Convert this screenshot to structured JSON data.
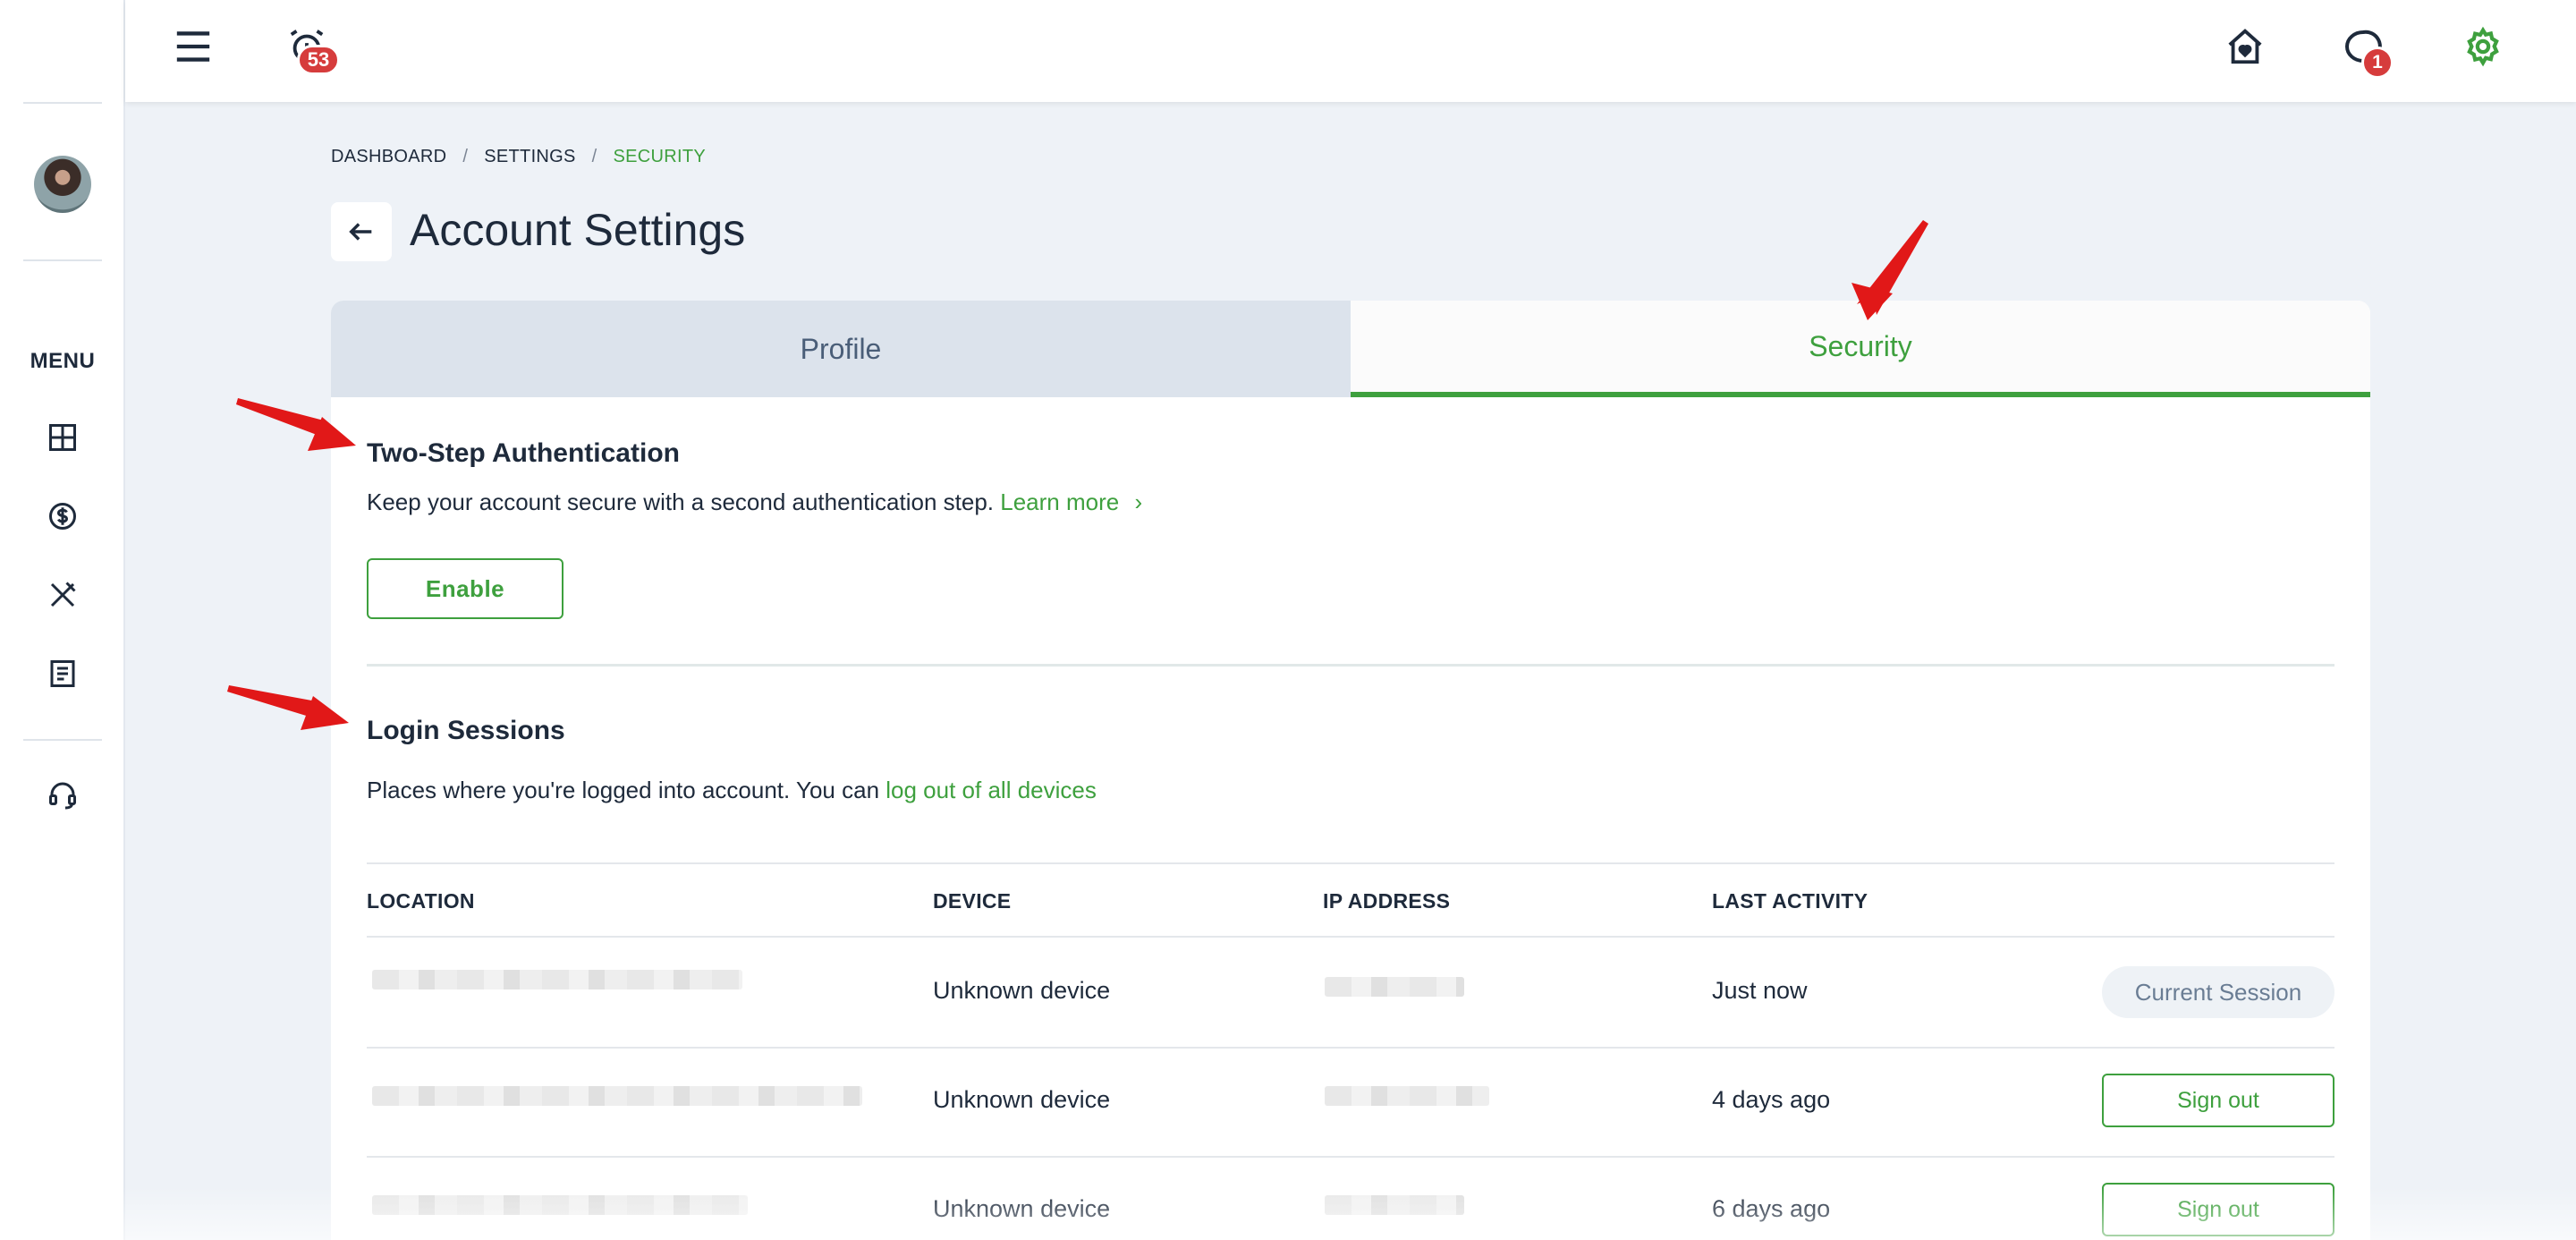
{
  "topbar": {
    "alarm_badge": "53",
    "chat_badge": "1"
  },
  "sidebar": {
    "menu_label": "MENU"
  },
  "breadcrumb": {
    "items": [
      "DASHBOARD",
      "SETTINGS",
      "SECURITY"
    ],
    "separator": "/"
  },
  "page": {
    "title": "Account Settings"
  },
  "tabs": [
    {
      "label": "Profile",
      "active": false
    },
    {
      "label": "Security",
      "active": true
    }
  ],
  "two_step": {
    "heading": "Two-Step Authentication",
    "description": "Keep your account secure with a second authentication step.",
    "learn_more": "Learn more",
    "enable_label": "Enable"
  },
  "sessions": {
    "heading": "Login Sessions",
    "description": "Places where you're logged into account. You can",
    "logout_link": "log out of all devices",
    "columns": [
      "LOCATION",
      "DEVICE",
      "IP ADDRESS",
      "LAST ACTIVITY"
    ],
    "rows": [
      {
        "device": "Unknown device",
        "last_activity": "Just now",
        "action": "Current Session"
      },
      {
        "device": "Unknown device",
        "last_activity": "4 days ago",
        "action": "Sign out"
      },
      {
        "device": "Unknown device",
        "last_activity": "6 days ago",
        "action": "Sign out"
      }
    ]
  },
  "colors": {
    "accent": "#3ea03e",
    "badge": "#d63c3c",
    "text": "#1e2a3b",
    "background": "#eef2f7"
  },
  "icons": [
    "hamburger-icon",
    "alarm-icon",
    "home-heart-icon",
    "chat-icon",
    "settings-gear-icon",
    "back-arrow-icon",
    "dashboard-icon",
    "dollar-icon",
    "tools-icon",
    "document-icon",
    "headset-icon",
    "chevron-right-icon"
  ]
}
